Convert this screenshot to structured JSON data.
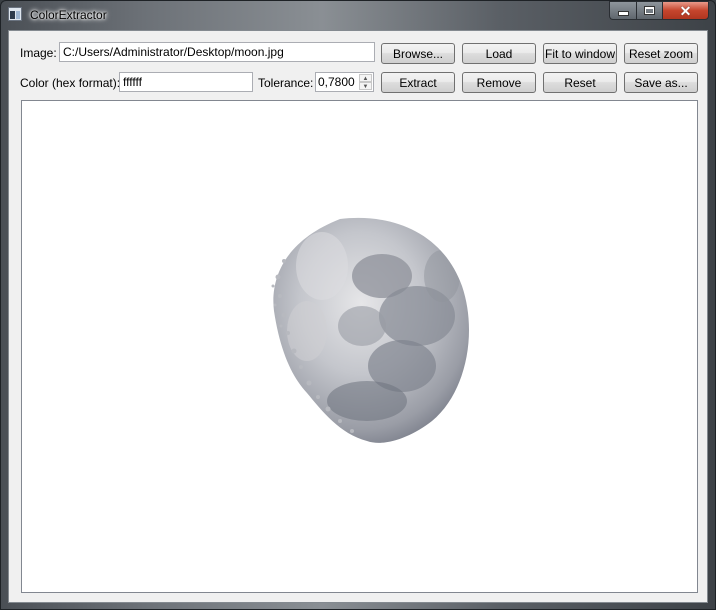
{
  "window": {
    "title": "ColorExtractor"
  },
  "controls": {
    "image_label": "Image:",
    "image_path": "C:/Users/Administrator/Desktop/moon.jpg",
    "color_label": "Color (hex format):",
    "color_value": "ffffff",
    "tolerance_label": "Tolerance:",
    "tolerance_value": "0,7800"
  },
  "buttons": {
    "browse": "Browse...",
    "load": "Load",
    "fit": "Fit to window",
    "reset_zoom": "Reset zoom",
    "extract": "Extract",
    "remove": "Remove",
    "reset": "Reset",
    "save_as": "Save as..."
  },
  "icons": {
    "app": "app-window-icon",
    "minimize": "minimize-icon",
    "maximize": "maximize-icon",
    "close": "close-icon",
    "spin_up": "spin-up-arrow-icon",
    "spin_down": "spin-down-arrow-icon"
  },
  "image_preview": {
    "subject": "moon-image"
  }
}
